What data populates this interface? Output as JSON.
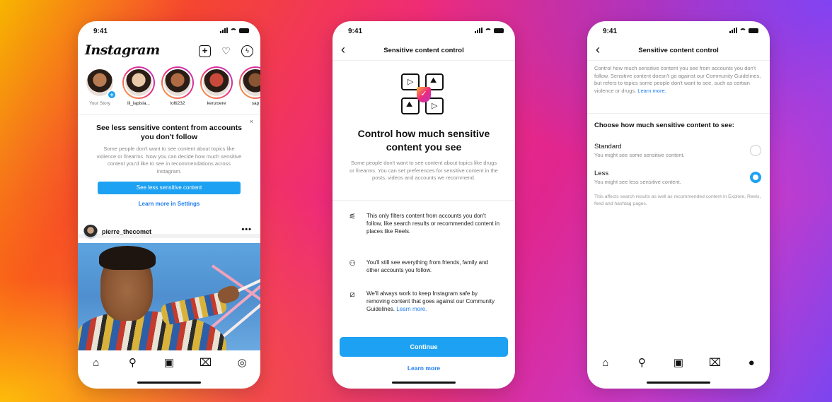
{
  "status_time": "9:41",
  "feed": {
    "logo": "Instagram",
    "header_icons": [
      "add-post-icon",
      "heart-icon",
      "messenger-icon"
    ],
    "stories": [
      {
        "label": "Your Story",
        "own": true,
        "color": "#b87b52"
      },
      {
        "label": "lil_lapisla...",
        "color": "#e8c9a8"
      },
      {
        "label": "lofti232",
        "color": "#b06a44"
      },
      {
        "label": "kenzoere",
        "color": "#c94a3a"
      },
      {
        "label": "sap",
        "color": "#8a5532"
      }
    ],
    "card": {
      "title": "See less sensitive content from accounts you don't follow",
      "body": "Some people don't want to see content about topics like violence or firearms. Now you can decide how much sensitive content you'd like to see in recommendations across Instagram.",
      "button": "See less sensitive content",
      "link": "Learn more in Settings",
      "close": "×"
    },
    "post": {
      "username": "pierre_thecomet",
      "more": "•••"
    },
    "tabs": [
      "home-icon",
      "search-icon",
      "reels-icon",
      "shop-icon",
      "profile-icon"
    ]
  },
  "intro": {
    "header_title": "Sensitive content control",
    "title": "Control how much sensitive content you see",
    "body": "Some people don't want to see content about topics like drugs or firearms. You can set preferences for sensitive content in the posts, videos and accounts we recommend.",
    "bullets": [
      {
        "icon": "sliders-icon",
        "text": "This only filters content from accounts you don't follow, like search results or recommended content in places like Reels."
      },
      {
        "icon": "people-icon",
        "text": "You'll still see everything from friends, family and other accounts you follow."
      },
      {
        "icon": "image-shield-icon",
        "text": "We'll always work to keep Instagram safe by removing content that goes against our Community Guidelines.",
        "link": "Learn more."
      }
    ],
    "continue_button": "Continue",
    "learn_more": "Learn more"
  },
  "settings": {
    "header_title": "Sensitive content control",
    "intro": "Control how much sensitive content you see from accounts you don't follow. Sensitive content doesn't go against our Community Guidelines, but refers to topics some people don't want to see, such as certain violence or drugs.",
    "intro_link": "Learn more.",
    "heading": "Choose how much sensitive content to see:",
    "options": [
      {
        "name": "Standard",
        "desc": "You might see some sensitive content.",
        "selected": false
      },
      {
        "name": "Less",
        "desc": "You might see less sensitive content.",
        "selected": true
      }
    ],
    "note": "This affects search results as well as recommended content in Explore, Reels, feed and hashtag pages.",
    "tabs": [
      "home-icon",
      "search-icon",
      "reels-icon",
      "shop-icon",
      "profile-icon"
    ]
  },
  "colors": {
    "accent": "#1da1f2",
    "link": "#1d7cf0"
  }
}
